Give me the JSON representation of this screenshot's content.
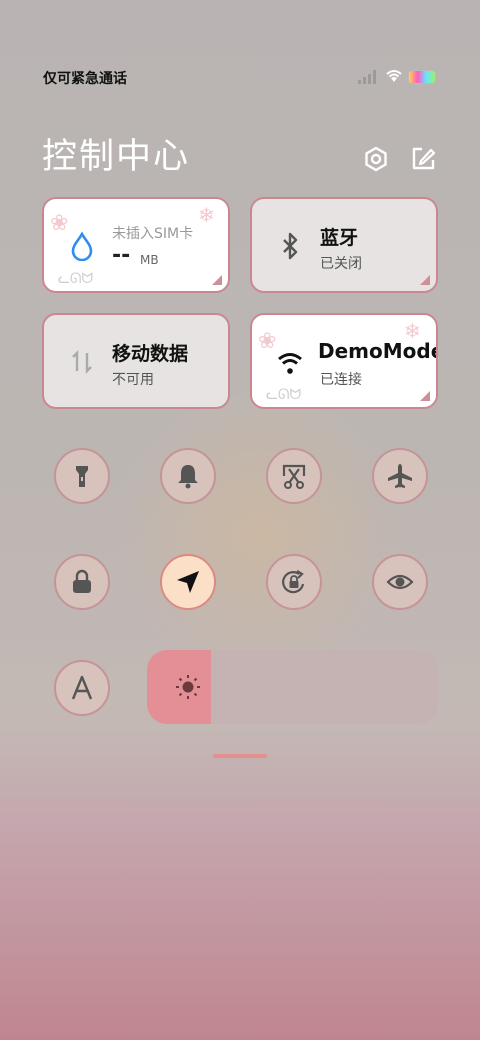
{
  "status_bar": {
    "carrier_text": "仅可紧急通话"
  },
  "header": {
    "title": "控制中心"
  },
  "tiles": {
    "data_usage": {
      "line1": "未插入SIM卡",
      "value": "--",
      "unit": "MB"
    },
    "bluetooth": {
      "name": "蓝牙",
      "state": "已关闭"
    },
    "mobile_data": {
      "name": "移动数据",
      "state": "不可用"
    },
    "wifi": {
      "name": "DemoMode",
      "state": "已连接"
    }
  },
  "quick_toggles": [
    {
      "icon": "flashlight-icon",
      "active": false
    },
    {
      "icon": "bell-icon",
      "active": false
    },
    {
      "icon": "screenshot-icon",
      "active": false
    },
    {
      "icon": "airplane-icon",
      "active": false
    },
    {
      "icon": "lock-icon",
      "active": false
    },
    {
      "icon": "location-icon",
      "active": true
    },
    {
      "icon": "rotation-lock-icon",
      "active": false
    },
    {
      "icon": "eye-icon",
      "active": false
    },
    {
      "icon": "font-icon",
      "active": false
    }
  ],
  "brightness": {
    "level": 0.22,
    "icon": "sun-icon"
  },
  "colors": {
    "accent": "#e48f96",
    "tile_border": "#c98890",
    "active_toggle": "#fbe0c7"
  }
}
